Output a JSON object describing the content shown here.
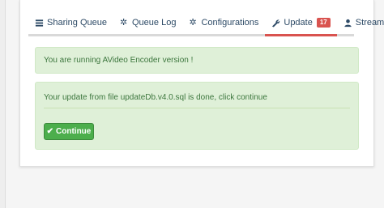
{
  "tabs": [
    {
      "label": "Sharing Queue",
      "icon": "tasks-icon"
    },
    {
      "label": "Queue Log",
      "icon": "cog-icon"
    },
    {
      "label": "Configurations",
      "icon": "cog-icon"
    },
    {
      "label": "Update",
      "icon": "wrench-icon",
      "badge": "17",
      "active": true
    },
    {
      "label": "Streamers",
      "icon": "user-icon"
    }
  ],
  "version_alert": {
    "text": "You are running AVideo Encoder version !"
  },
  "update_alert": {
    "text": "Your update from file updateDb.v4.0.sql is done, click continue",
    "button_label": "Continue",
    "button_icon": "check-icon"
  },
  "colors": {
    "accent": "#d9534f",
    "success_bg": "#dff0d8",
    "success_text": "#3c763d",
    "button": "#4cae4c",
    "tab_text": "#2d4a66"
  }
}
